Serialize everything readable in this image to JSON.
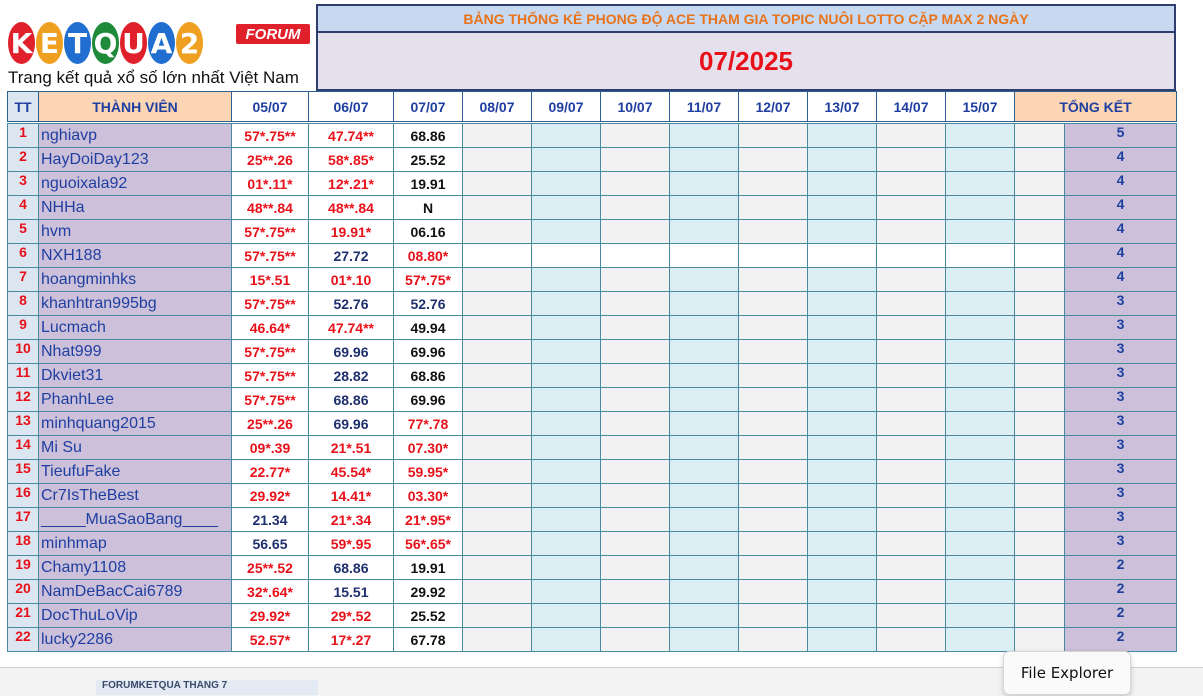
{
  "logo": {
    "letters": [
      "K",
      "E",
      "T",
      "Q",
      "U",
      "A",
      "2"
    ],
    "letter_colors": [
      "#e0202a",
      "#f0a020",
      "#1f6ed0",
      "#1f8a3a",
      "#e0202a",
      "#1f6ed0",
      "#f0a020"
    ],
    "badge": "FORUM",
    "tagline": "Trang kết quả xổ số lớn nhất Việt Nam"
  },
  "header": {
    "title": "BẢNG THỐNG KÊ PHONG ĐỘ ACE THAM GIA TOPIC NUÔI LOTTO CẶP MAX 2 NGÀY",
    "month": "07/2025",
    "col_tt": "TT",
    "col_name": "THÀNH VIÊN",
    "dates": [
      "05/07",
      "06/07",
      "07/07",
      "08/07",
      "09/07",
      "10/07",
      "11/07",
      "12/07",
      "13/07",
      "14/07",
      "15/07"
    ],
    "col_total": "TỔNG KẾT"
  },
  "colors": {
    "red": "#e8111a",
    "orange": "#e8731a",
    "name_bg": "#ccc0da",
    "blue_text": "#1f3fa0"
  },
  "rows": [
    {
      "tt": "1",
      "name": "nghiavp",
      "d": [
        "57*.75**",
        "47.74**",
        "68.86"
      ],
      "c": [
        "red",
        "red",
        "blk"
      ],
      "total": "5"
    },
    {
      "tt": "2",
      "name": "HayDoiDay123",
      "d": [
        "25**.26",
        "58*.85*",
        "25.52"
      ],
      "c": [
        "red",
        "red",
        "blk"
      ],
      "total": "4"
    },
    {
      "tt": "3",
      "name": "nguoixala92",
      "d": [
        "01*.11*",
        "12*.21*",
        "19.91"
      ],
      "c": [
        "red",
        "red",
        "blk"
      ],
      "total": "4"
    },
    {
      "tt": "4",
      "name": "NHHa",
      "d": [
        "48**.84",
        "48**.84",
        "N"
      ],
      "c": [
        "red",
        "red",
        "blk"
      ],
      "total": "4"
    },
    {
      "tt": "5",
      "name": "hvm",
      "d": [
        "57*.75**",
        "19.91*",
        "06.16"
      ],
      "c": [
        "red",
        "red",
        "blk"
      ],
      "total": "4"
    },
    {
      "tt": "6",
      "name": "NXH188",
      "d": [
        "57*.75**",
        "27.72",
        "08.80*"
      ],
      "c": [
        "red",
        "nav",
        "red"
      ],
      "total": "4"
    },
    {
      "tt": "7",
      "name": "hoangminhks",
      "d": [
        "15*.51",
        "01*.10",
        "57*.75*"
      ],
      "c": [
        "red",
        "red",
        "red"
      ],
      "total": "4"
    },
    {
      "tt": "8",
      "name": "khanhtran995bg",
      "d": [
        "57*.75**",
        "52.76",
        "52.76"
      ],
      "c": [
        "red",
        "nav",
        "nav"
      ],
      "total": "3"
    },
    {
      "tt": "9",
      "name": "Lucmach",
      "d": [
        "46.64*",
        "47.74**",
        "49.94"
      ],
      "c": [
        "red",
        "red",
        "blk"
      ],
      "total": "3"
    },
    {
      "tt": "10",
      "name": "Nhat999",
      "d": [
        "57*.75**",
        "69.96",
        "69.96"
      ],
      "c": [
        "red",
        "nav",
        "blk"
      ],
      "total": "3"
    },
    {
      "tt": "11",
      "name": "Dkviet31",
      "d": [
        "57*.75**",
        "28.82",
        "68.86"
      ],
      "c": [
        "red",
        "nav",
        "blk"
      ],
      "total": "3"
    },
    {
      "tt": "12",
      "name": "PhanhLee",
      "d": [
        "57*.75**",
        "68.86",
        "69.96"
      ],
      "c": [
        "red",
        "nav",
        "blk"
      ],
      "total": "3"
    },
    {
      "tt": "13",
      "name": "minhquang2015",
      "d": [
        "25**.26",
        "69.96",
        "77*.78"
      ],
      "c": [
        "red",
        "nav",
        "red"
      ],
      "total": "3"
    },
    {
      "tt": "14",
      "name": "Mi Su",
      "d": [
        "09*.39",
        "21*.51",
        "07.30*"
      ],
      "c": [
        "red",
        "red",
        "red"
      ],
      "total": "3"
    },
    {
      "tt": "15",
      "name": "TieufuFake",
      "d": [
        "22.77*",
        "45.54*",
        "59.95*"
      ],
      "c": [
        "red",
        "red",
        "red"
      ],
      "total": "3"
    },
    {
      "tt": "16",
      "name": "Cr7IsTheBest",
      "d": [
        "29.92*",
        "14.41*",
        "03.30*"
      ],
      "c": [
        "red",
        "red",
        "red"
      ],
      "total": "3"
    },
    {
      "tt": "17",
      "name": "_____MuaSaoBang____",
      "d": [
        "21.34",
        "21*.34",
        "21*.95*"
      ],
      "c": [
        "nav",
        "red",
        "red"
      ],
      "total": "3"
    },
    {
      "tt": "18",
      "name": "minhmap",
      "d": [
        "56.65",
        "59*.95",
        "56*.65*"
      ],
      "c": [
        "nav",
        "red",
        "red"
      ],
      "total": "3"
    },
    {
      "tt": "19",
      "name": "Chamy1108",
      "d": [
        "25**.52",
        "68.86",
        "19.91"
      ],
      "c": [
        "red",
        "nav",
        "blk"
      ],
      "total": "2"
    },
    {
      "tt": "20",
      "name": "NamDeBacCai6789",
      "d": [
        "32*.64*",
        "15.51",
        "29.92"
      ],
      "c": [
        "red",
        "nav",
        "blk"
      ],
      "total": "2"
    },
    {
      "tt": "21",
      "name": "DocThuLoVip",
      "d": [
        "29.92*",
        "29*.52",
        "25.52"
      ],
      "c": [
        "red",
        "red",
        "blk"
      ],
      "total": "2"
    },
    {
      "tt": "22",
      "name": "lucky2286",
      "d": [
        "52.57*",
        "17*.27",
        "67.78"
      ],
      "c": [
        "red",
        "red",
        "blk"
      ],
      "total": "2"
    }
  ],
  "sheet_tab": "FORUMKETQUA THÁNG 7",
  "tooltip": "File Explorer"
}
